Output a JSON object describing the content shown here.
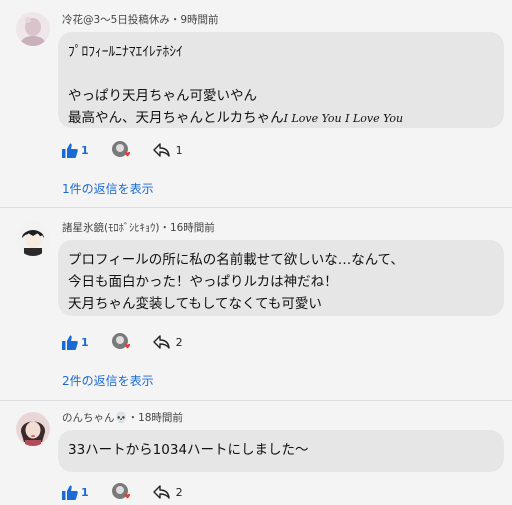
{
  "comments": [
    {
      "meta": "冷花@3〜5日投稿休み・9時間前",
      "lines": [
        "ﾌﾟﾛﾌｨｰﾙﾆﾅﾏｴｲﾚﾃﾎｼｲ",
        "",
        "やっぱり天月ちゃん可愛いやん",
        "最高やん、天月ちゃんとルカちゃん"
      ],
      "italic_tail": "I Love You I Love You",
      "like_count": "1",
      "reply_count": "1",
      "replies_link": "1件の返信を表示"
    },
    {
      "meta": "諸星氷鏡(ﾓﾛﾎﾞｼﾋｷｮｳ)・16時間前",
      "lines": [
        "プロフィールの所に私の名前載せて欲しいな…なんて、",
        "今日も面白かった！やっぱりルカは神だね！",
        "天月ちゃん変装してもしてなくても可愛い"
      ],
      "like_count": "1",
      "reply_count": "2",
      "replies_link": "2件の返信を表示"
    },
    {
      "meta": "のんちゃん💀・18時間前",
      "lines": [
        "33ハートから1034ハートにしました〜"
      ],
      "like_count": "1",
      "reply_count": "2"
    }
  ],
  "colors": {
    "accent": "#1a6ad6",
    "heart": "#e53935"
  },
  "icons": [
    "thumbs-up-icon",
    "heart-avatar-icon",
    "reply-icon"
  ]
}
